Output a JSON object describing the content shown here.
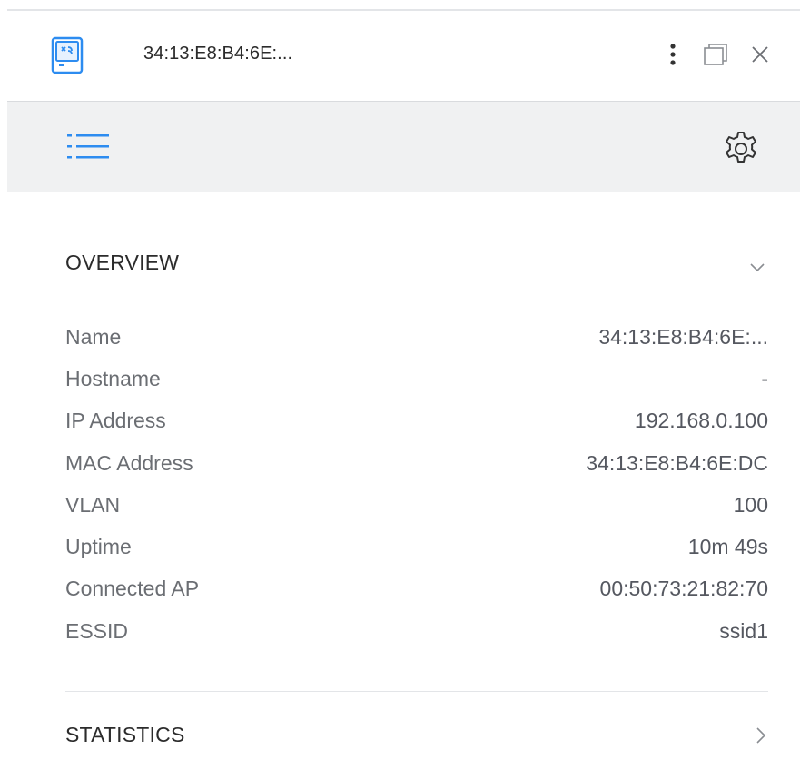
{
  "header": {
    "device_name": "34:13:E8:B4:6E:...",
    "device_icon": "wireless-client-icon",
    "actions": [
      "more-options-icon",
      "restore-window-icon",
      "close-icon"
    ]
  },
  "toolbar": {
    "left_icon": "list-view-icon",
    "right_icon": "gear-icon"
  },
  "overview": {
    "title": "OVERVIEW",
    "expanded": true,
    "rows": [
      {
        "label": "Name",
        "value": "34:13:E8:B4:6E:..."
      },
      {
        "label": "Hostname",
        "value": "-"
      },
      {
        "label": "IP Address",
        "value": "192.168.0.100"
      },
      {
        "label": "MAC Address",
        "value": "34:13:E8:B4:6E:DC"
      },
      {
        "label": "VLAN",
        "value": "100"
      },
      {
        "label": "Uptime",
        "value": "10m 49s"
      },
      {
        "label": "Connected AP",
        "value": "00:50:73:21:82:70"
      },
      {
        "label": "ESSID",
        "value": "ssid1"
      }
    ]
  },
  "statistics": {
    "title": "STATISTICS",
    "expanded": false
  },
  "colors": {
    "accent": "#2d8cf0",
    "toolbar_bg": "#f0f1f2",
    "label": "#6b6e73",
    "value": "#555860"
  }
}
